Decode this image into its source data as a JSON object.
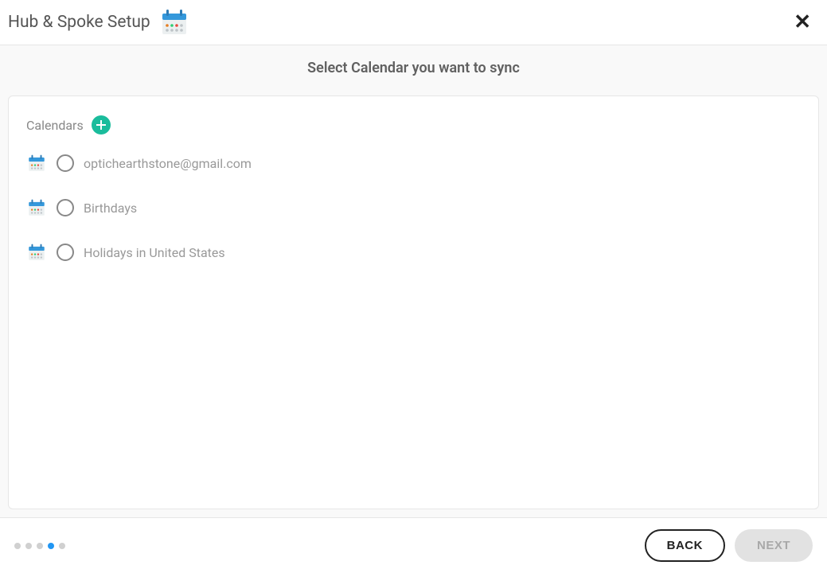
{
  "header": {
    "title": "Hub & Spoke Setup"
  },
  "content": {
    "subtitle": "Select Calendar you want to sync",
    "panel_heading": "Calendars",
    "calendars": [
      {
        "label": "optichearthstone@gmail.com"
      },
      {
        "label": "Birthdays"
      },
      {
        "label": "Holidays in United States"
      }
    ]
  },
  "footer": {
    "steps_total": 5,
    "step_active_index": 3,
    "back_label": "BACK",
    "next_label": "NEXT"
  }
}
